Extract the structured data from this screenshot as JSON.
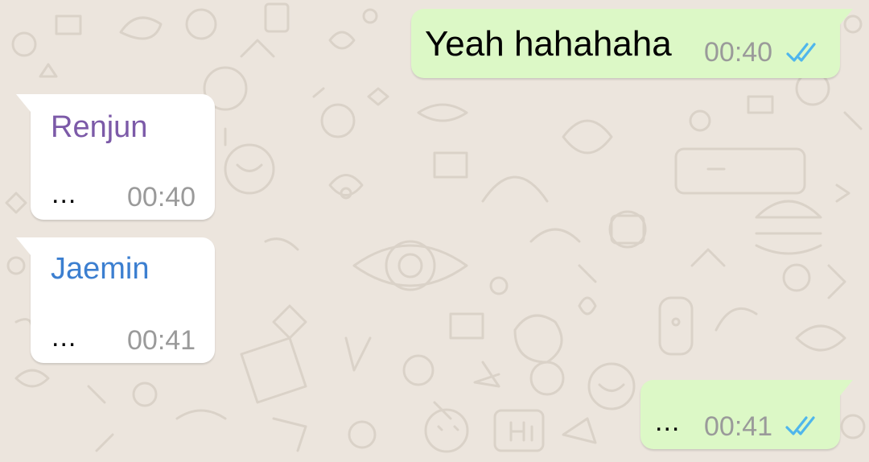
{
  "wallpaper": {
    "color": "#ECE5DD",
    "doodle_color": "#DAD2C8"
  },
  "messages": [
    {
      "direction": "outgoing",
      "text": "Yeah hahahaha",
      "time": "00:40",
      "status": "double-check-read"
    },
    {
      "direction": "incoming",
      "sender": "Renjun",
      "sender_color": "#7C5AA8",
      "text": "...",
      "time": "00:40"
    },
    {
      "direction": "incoming",
      "sender": "Jaemin",
      "sender_color": "#3C7FD0",
      "text": "...",
      "time": "00:41"
    },
    {
      "direction": "outgoing",
      "text": "...",
      "time": "00:41",
      "status": "double-check-read"
    }
  ],
  "colors": {
    "outgoing_bubble": "#DCF8C6",
    "incoming_bubble": "#FFFFFF",
    "read_ticks": "#4FB6EC",
    "timestamp": "#9A9A9A"
  }
}
